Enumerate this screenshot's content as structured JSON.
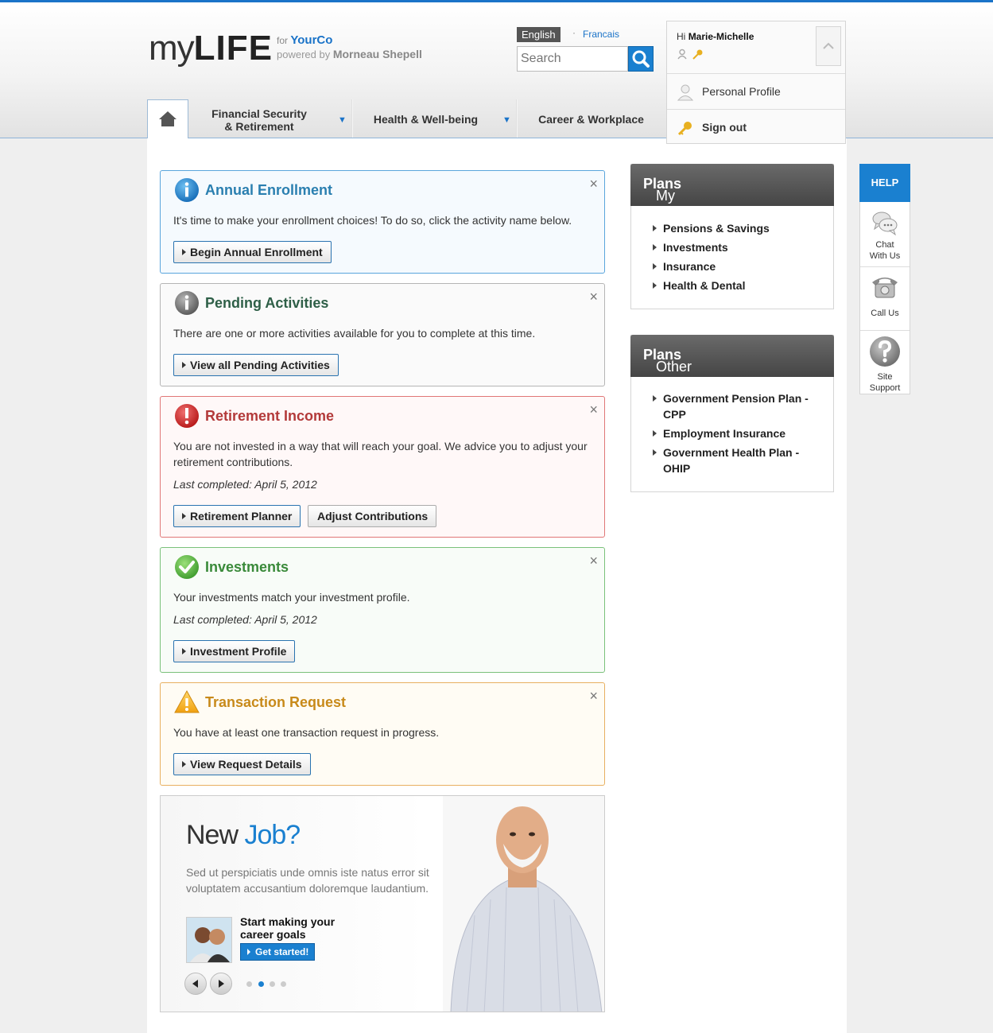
{
  "header": {
    "logo_my": "my",
    "logo_life": "LIFE",
    "for_label": "for",
    "company": "YourCo",
    "powered_by": "powered by",
    "provider": "Morneau Shepell",
    "lang_active": "English",
    "lang_separator": "·",
    "lang_other": "Francais",
    "search_placeholder": "Search"
  },
  "user": {
    "greeting": "Hi",
    "name": "Marie-Michelle",
    "profile_label": "Personal Profile",
    "signout_label": "Sign out"
  },
  "nav": {
    "items": [
      {
        "label_line1": "Financial Security",
        "label_line2": "& Retirement",
        "has_menu": true
      },
      {
        "label": "Health & Well-being",
        "has_menu": true
      },
      {
        "label": "Career & Workplace",
        "has_menu": false
      }
    ]
  },
  "alerts": [
    {
      "title": "Annual Enrollment",
      "type": "info",
      "title_color": "#2a7fb0",
      "text": "It's time to make your enrollment choices! To do so, click the activity name below.",
      "buttons": [
        "Begin Annual Enrollment"
      ]
    },
    {
      "title": "Pending Activities",
      "type": "neutral",
      "title_color": "#2e5f47",
      "text": "There are one or more activities available for you to complete at this time.",
      "buttons": [
        "View all Pending Activities"
      ]
    },
    {
      "title": "Retirement Income",
      "type": "error",
      "title_color": "#b33a3a",
      "text": "You are not invested in a way that will reach your goal. We advice you to adjust your retirement contributions.",
      "last_completed": "Last completed: April 5, 2012",
      "buttons": [
        "Retirement Planner",
        "Adjust Contributions"
      ]
    },
    {
      "title": "Investments",
      "type": "success",
      "title_color": "#3a8a3a",
      "text": "Your investments match your investment profile.",
      "last_completed": "Last completed: April 5, 2012",
      "buttons": [
        "Investment Profile"
      ]
    },
    {
      "title": "Transaction Request",
      "type": "warning",
      "title_color": "#c88a1a",
      "text": "You have at least one transaction request in progress.",
      "buttons": [
        "View Request Details"
      ]
    }
  ],
  "close_glyph": "×",
  "promo": {
    "title_plain": "New",
    "title_accent": "Job?",
    "description": "Sed ut perspiciatis unde omnis iste natus error sit voluptatem accusantium doloremque laudantium.",
    "cta_text": "Start making your career goals",
    "cta_button": "Get started!",
    "slides": 4,
    "active_slide": 2
  },
  "my_plans": {
    "title_plain": "My",
    "title_bold": "Plans",
    "items": [
      "Pensions & Savings",
      "Investments",
      "Insurance",
      "Health & Dental"
    ]
  },
  "other_plans": {
    "title_plain": "Other",
    "title_bold": "Plans",
    "items": [
      "Government Pension Plan - CPP",
      "Employment Insurance",
      "Government Health Plan - OHIP"
    ]
  },
  "help": {
    "title": "HELP",
    "chat": "Chat With Us",
    "call": "Call Us",
    "support": "Site Support"
  },
  "colors": {
    "accent": "#1a80d0",
    "header_bar": "#1a73c8"
  }
}
